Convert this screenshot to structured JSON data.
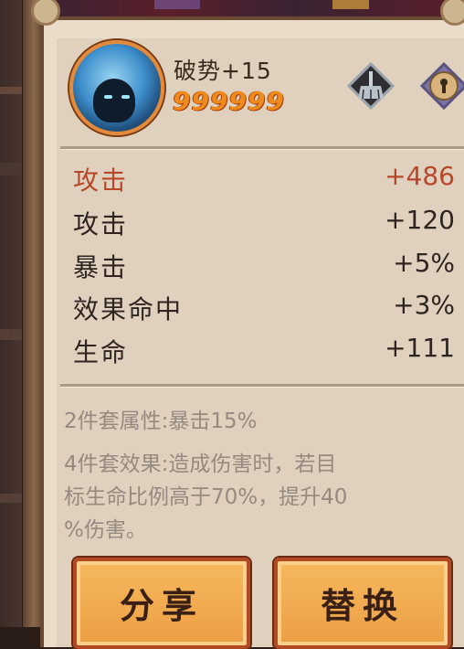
{
  "item": {
    "name": "破势+15",
    "score": "999999"
  },
  "main_stat": {
    "name": "攻击",
    "value": "+486"
  },
  "sub_stats": [
    {
      "name": "攻击",
      "value": "+120"
    },
    {
      "name": "暴击",
      "value": "+5%"
    },
    {
      "name": "效果命中",
      "value": "+3%"
    },
    {
      "name": "生命",
      "value": "+111"
    }
  ],
  "set_bonus": {
    "two_piece": "2件套属性:暴击15%",
    "four_piece_line1": "4件套效果:造成伤害时，若目",
    "four_piece_line2": "标生命比例高于70%，提升40",
    "four_piece_line3": "%伤害。"
  },
  "buttons": {
    "share": "分享",
    "replace": "替换"
  },
  "icons": {
    "avatar": "character-avatar",
    "diamond": "broom-diamond-icon",
    "lock": "lock-diamond-icon"
  },
  "colors": {
    "main_stat": "#b8472a",
    "score": "#ef8a1d",
    "button": "#f1a94e"
  }
}
